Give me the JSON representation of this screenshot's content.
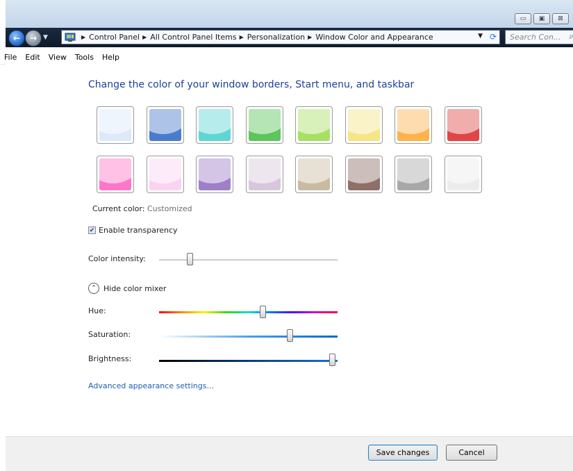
{
  "window": {
    "controls": {
      "minimize_icon": "minimize-icon",
      "maximize_icon": "maximize-icon",
      "close_label": "⊠"
    }
  },
  "address": {
    "breadcrumbs": [
      "Control Panel",
      "All Control Panel Items",
      "Personalization",
      "Window Color and Appearance"
    ],
    "search_placeholder": "Search Con..."
  },
  "menu": {
    "items": [
      "File",
      "Edit",
      "View",
      "Tools",
      "Help"
    ]
  },
  "main": {
    "heading": "Change the color of your window borders, Start menu, and taskbar",
    "swatches_row1": [
      "#dbe9fb",
      "#4b7ccc",
      "#5fd6d4",
      "#5cc55c",
      "#a8e066",
      "#f5e585",
      "#ffb24a",
      "#df4747"
    ],
    "swatches_row2": [
      "#ff76c8",
      "#fbd3f2",
      "#9f7fc9",
      "#d8c7dc",
      "#c9bba2",
      "#8f6f67",
      "#a8a8a8",
      "#ececec"
    ],
    "current_color_label": "Current color:",
    "current_color_value": "Customized",
    "transparency_label": "Enable transparency",
    "transparency_checked": true,
    "intensity_label": "Color intensity:",
    "intensity_level": 0.17,
    "mixer_toggle_label": "Hide color mixer",
    "hue_label": "Hue:",
    "hue_level": 0.58,
    "saturation_label": "Saturation:",
    "saturation_level": 0.73,
    "brightness_label": "Brightness:",
    "brightness_level": 0.97,
    "advanced_link": "Advanced appearance settings..."
  },
  "footer": {
    "save_label": "Save changes",
    "cancel_label": "Cancel"
  }
}
